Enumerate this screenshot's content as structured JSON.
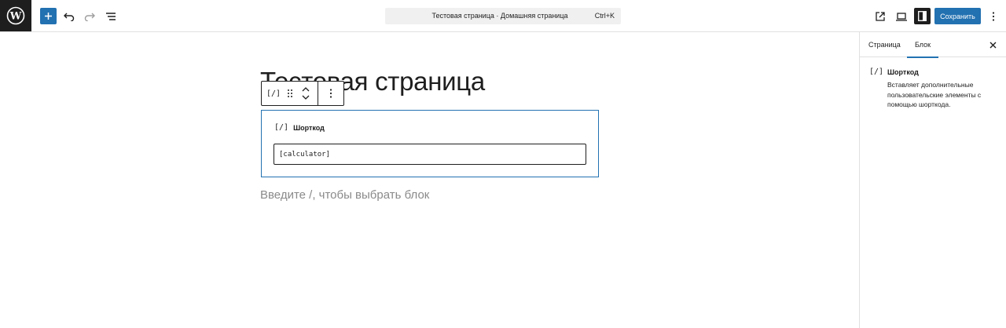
{
  "topbar": {
    "command_title": "Тестовая страница · Домашняя страница",
    "command_shortcut": "Ctrl+K",
    "save_label": "Сохранить"
  },
  "editor": {
    "page_title": "Тестовая страница",
    "block_toolbar": {
      "block_icon": "[/]"
    },
    "shortcode_block": {
      "icon": "[/]",
      "label": "Шорткод",
      "value": "[calculator]"
    },
    "placeholder": "Введите /, чтобы выбрать блок"
  },
  "sidebar": {
    "tabs": [
      {
        "label": "Страница",
        "active": false
      },
      {
        "label": "Блок",
        "active": true
      }
    ],
    "block": {
      "icon": "[/]",
      "title": "Шорткод",
      "description": "Вставляет дополнительные пользовательские элементы с помощью шорткода."
    }
  },
  "colors": {
    "accent": "#2271b1",
    "dark": "#1e1e1e",
    "placeholder": "#8a8a8a"
  }
}
